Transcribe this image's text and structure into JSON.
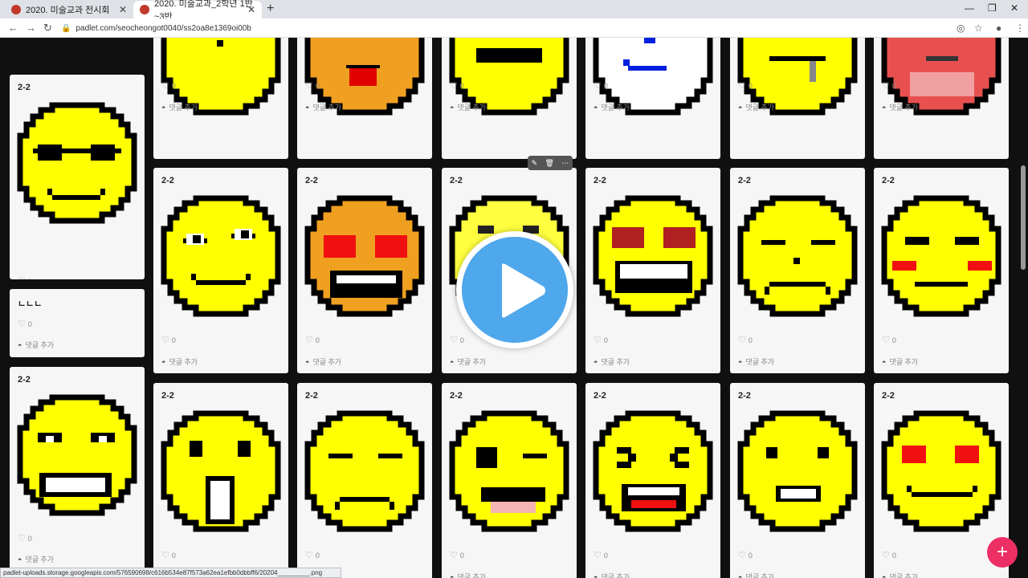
{
  "browser": {
    "tabs": [
      {
        "title": "2020. 미술교과 전시회",
        "active": false
      },
      {
        "title": "2020. 미술교과_2학년 1반~3반",
        "active": true
      }
    ],
    "url": "padlet.com/seocheongot0040/ss2oa8e1369oi00b",
    "status_url": "padlet-uploads.storage.googleapis.com/576590698/c616b534e87f573a62ea1efbb0dbbff6/20204_________.png"
  },
  "board": {
    "like_count": "0",
    "comment_label": "댓글 추가",
    "toolbar_icons": [
      "pencil-icon",
      "trash-icon",
      "more-icon"
    ],
    "fab_label": "+"
  },
  "posts": [
    {
      "title": "",
      "face": "dot-face"
    },
    {
      "title": "",
      "face": "surprised-orange"
    },
    {
      "title": "",
      "face": "flat-mouth"
    },
    {
      "title": "",
      "face": "blue-sketch"
    },
    {
      "title": "",
      "face": "tear-face"
    },
    {
      "title": "",
      "face": "red-angry"
    },
    {
      "title": "2-2",
      "face": "sunglasses"
    },
    {
      "title": "ㄴㄴㄴ",
      "face": "none"
    },
    {
      "title": "2-2",
      "face": "grimace"
    },
    {
      "title": "2-2",
      "face": "laughing-squint"
    },
    {
      "title": "2-2",
      "face": "heart-eyes-orange"
    },
    {
      "title": "2-2",
      "face": "video-face"
    },
    {
      "title": "2-2",
      "face": "heart-eyes-grin"
    },
    {
      "title": "2-2",
      "face": "sad-closed"
    },
    {
      "title": "2-2",
      "face": "blush-smile"
    },
    {
      "title": "2-2",
      "face": "shocked-o"
    },
    {
      "title": "2-2",
      "face": "sleepy-frown"
    },
    {
      "title": "2-2",
      "face": "wink"
    },
    {
      "title": "2-2",
      "face": "xd-laugh"
    },
    {
      "title": "2-2",
      "face": "straight-smile"
    },
    {
      "title": "2-2",
      "face": "heart-eyes-smile"
    }
  ],
  "colors": {
    "face_yellow": "#ffff00",
    "outline": "#000000",
    "fab": "#ec2f64",
    "play": "#4fa7ec"
  }
}
